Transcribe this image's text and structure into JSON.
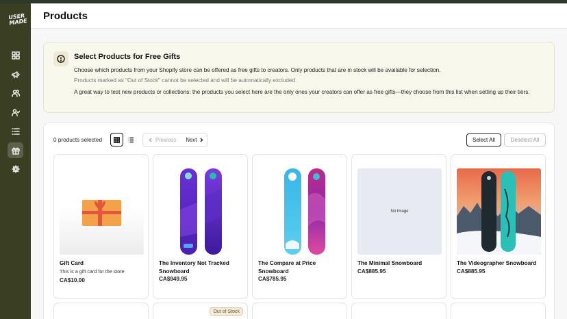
{
  "app": {
    "logo_text": "USER MADE",
    "accent": "#3a3f24"
  },
  "sidebar": {
    "items": [
      {
        "name": "dashboard",
        "icon": "grid-icon"
      },
      {
        "name": "campaigns",
        "icon": "megaphone-icon"
      },
      {
        "name": "creators",
        "icon": "users-icon"
      },
      {
        "name": "invites",
        "icon": "user-check-icon"
      },
      {
        "name": "lists",
        "icon": "list-icon"
      },
      {
        "name": "gifts",
        "icon": "gift-icon",
        "active": true
      },
      {
        "name": "settings",
        "icon": "gear-icon"
      }
    ]
  },
  "header": {
    "title": "Products"
  },
  "banner": {
    "icon": "info-icon",
    "title": "Select Products for Free Gifts",
    "line1": "Choose which products from your Shopify store can be offered as free gifts to creators. Only products that are in stock will be available for selection.",
    "line2": "Products marked as \"Out of Stock\" cannot be selected and will be automatically excluded.",
    "line3": "A great way to test new products or collections: the products you select here are the only ones your creators can offer as free gifts—they choose from this list when setting up their tiers."
  },
  "toolbar": {
    "selected_count": "0 products selected",
    "previous": "Previous",
    "next": "Next",
    "select_all": "Select All",
    "deselect_all": "Deselect All"
  },
  "products": [
    {
      "name": "Gift Card",
      "description": "This is a gift card for the store",
      "price": "CA$10.00",
      "image": "gift-card"
    },
    {
      "name": "The Inventory Not Tracked Snowboard",
      "price": "CA$949.95",
      "image": "purple-snowboard"
    },
    {
      "name": "The Compare at Price Snowboard",
      "price": "CA$785.95",
      "image": "blue-pink-snowboard"
    },
    {
      "name": "The Minimal Snowboard",
      "price": "CA$885.95",
      "image": "no-image",
      "no_image_text": "No Image"
    },
    {
      "name": "The Videographer Snowboard",
      "price": "CA$885.95",
      "image": "snow-scene-snowboard"
    }
  ],
  "second_row": {
    "out_of_stock_badge": "Out of Stock"
  }
}
